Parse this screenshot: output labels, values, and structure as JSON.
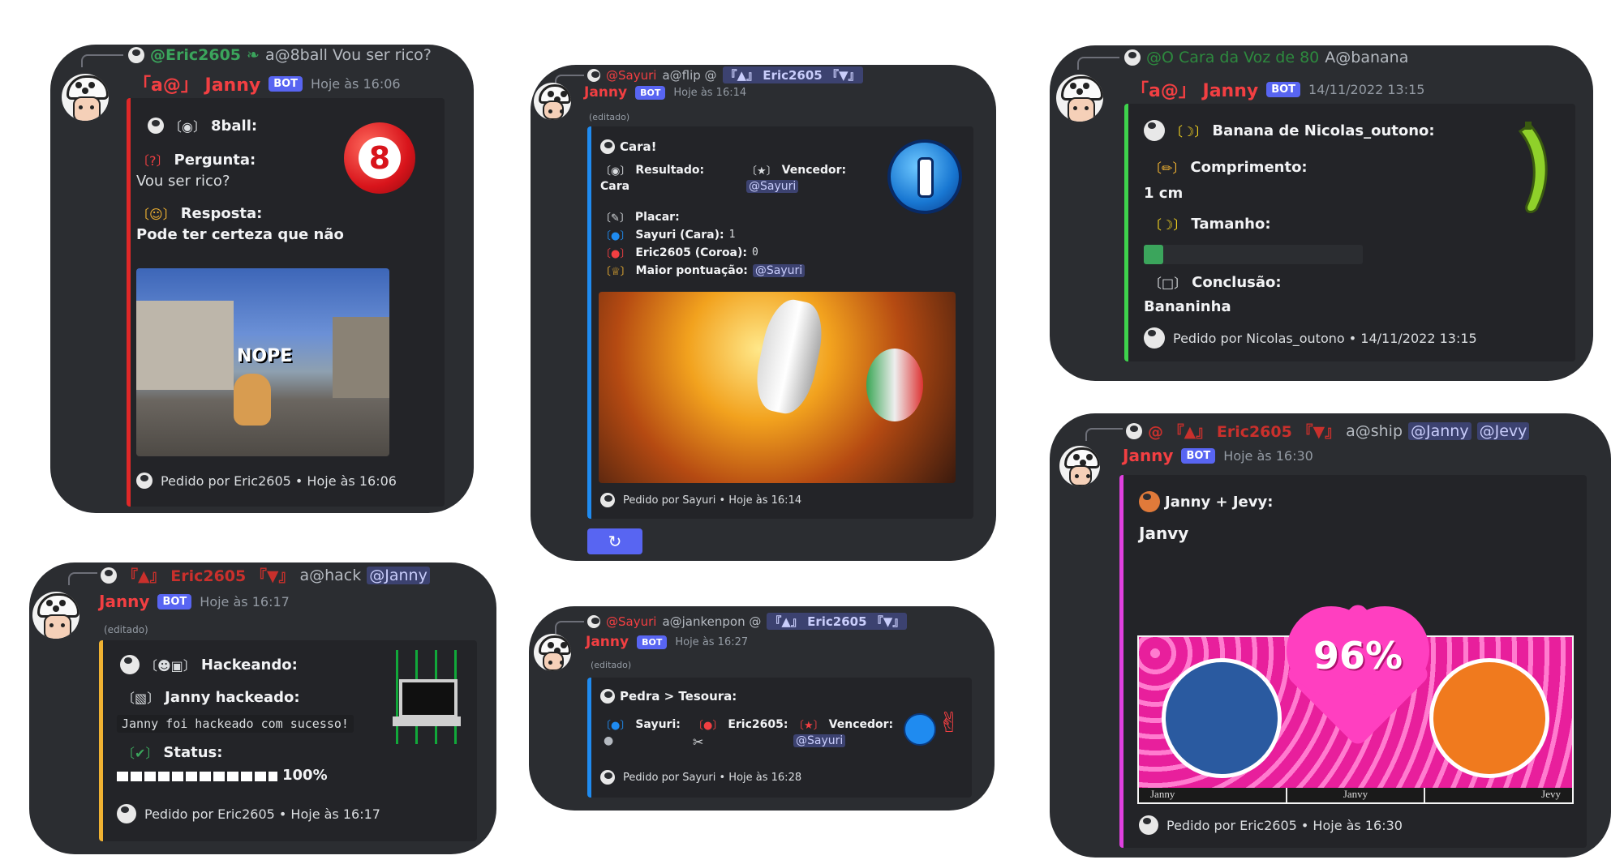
{
  "panel1": {
    "reply_user": "@Eric2605",
    "reply_text": "a@8ball Vou ser rico?",
    "username": "「a@」 Janny",
    "bot": "BOT",
    "time": "Hoje às 16:06",
    "title": "8ball:",
    "q_label": "Pergunta:",
    "q_value": "Vou ser rico?",
    "a_label": "Resposta:",
    "a_value": "Pode ter certeza que não",
    "ball_number": "8",
    "gif_text": "NOPE",
    "footer": "Pedido por Eric2605 • Hoje às 16:06",
    "accent": "#e02828"
  },
  "panel2": {
    "reply_user": "@Sayuri",
    "reply_cmd": "a@flip @",
    "reply_mention": "『▲』 Eric2605 『▼』",
    "username": "Janny",
    "bot": "BOT",
    "time": "Hoje às 16:14",
    "edited": "(editado)",
    "title": "Cara!",
    "result_label": "Resultado:",
    "result_value": "Cara",
    "winner_label": "Vencedor:",
    "winner_value": "@Sayuri",
    "score_label": "Placar:",
    "score1": "Sayuri (Cara):",
    "score1_value": "1",
    "score2": "Eric2605 (Coroa):",
    "score2_value": "0",
    "top_label": "Maior pontuação:",
    "top_value": "@Sayuri",
    "footer": "Pedido por Sayuri • Hoje às 16:14",
    "button_icon": "↻",
    "accent": "#1f8bf0"
  },
  "panel3": {
    "reply_user": "@O Cara da Voz de 80",
    "reply_text": "A@banana",
    "username": "「a@」 Janny",
    "bot": "BOT",
    "time": "14/11/2022 13:15",
    "title": "Banana de Nicolas_outono:",
    "len_label": "Comprimento:",
    "len_value": "1 cm",
    "size_label": "Tamanho:",
    "size_fraction": 0.09,
    "concl_label": "Conclusão:",
    "concl_value": "Bananinha",
    "footer": "Pedido por Nicolas_outono • 14/11/2022 13:15",
    "accent": "#3ed34c"
  },
  "panel4": {
    "reply_mention": "『▲』 Eric2605 『▼』",
    "reply_cmd": "a@hack",
    "reply_target": "@Janny",
    "username": "Janny",
    "bot": "BOT",
    "time": "Hoje às 16:17",
    "edited": "(editado)",
    "title": "Hackeando:",
    "hacked_label": "Janny hackeado:",
    "code": "Janny foi hackeado com sucesso!",
    "status_label": "Status:",
    "progress_text": "100%",
    "progress_fraction": 1.0,
    "footer": "Pedido por Eric2605 • Hoje às 16:17",
    "accent": "#f0b232"
  },
  "panel5": {
    "reply_user": "@Sayuri",
    "reply_cmd": "a@jankenpon @",
    "reply_mention": "『▲』 Eric2605 『▼』",
    "username": "Janny",
    "bot": "BOT",
    "time": "Hoje às 16:27",
    "edited": "(editado)",
    "title": "Pedra > Tesoura:",
    "p1_label": "Sayuri:",
    "p2_label": "Eric2605:",
    "winner_label": "Vencedor:",
    "winner_value": "@Sayuri",
    "footer": "Pedido por Sayuri • Hoje às 16:28",
    "accent": "#1f8bf0"
  },
  "panel6": {
    "reply_mention_user": "@ 『▲』 Eric2605 『▼』",
    "reply_cmd": "a@ship",
    "reply_target1": "@Janny",
    "reply_target2": "@Jevy",
    "username": "Janny",
    "bot": "BOT",
    "time": "Hoje às 16:30",
    "title": "Janny + Jevy:",
    "ship_name": "Janvy",
    "percent": "96%",
    "label_left": "Janny",
    "label_mid": "Janvy",
    "label_right": "Jevy",
    "footer": "Pedido por Eric2605 • Hoje às 16:30",
    "accent": "#e040e0"
  }
}
